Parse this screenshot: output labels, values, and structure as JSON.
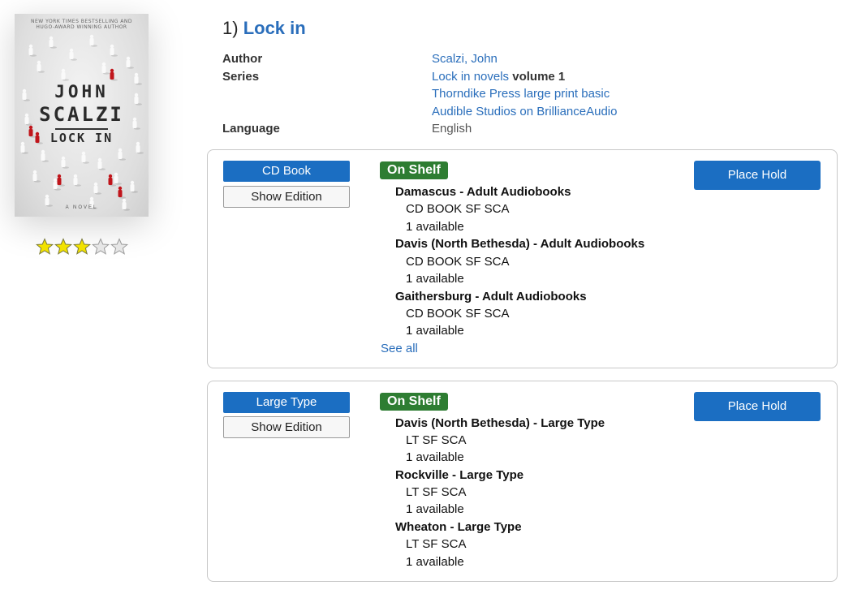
{
  "record": {
    "index": "1)",
    "title": "Lock in",
    "rating": 3,
    "rating_max": 5,
    "star_color": "#f2e200",
    "cover": {
      "tagline_1": "NEW YORK TIMES BESTSELLING AND",
      "tagline_2": "HUGO-AWARD WINNING AUTHOR",
      "author_first": "JOHN",
      "author_last": "SCALZI",
      "title": "LOCK IN",
      "subtitle": "A NOVEL"
    }
  },
  "details": {
    "author_label": "Author",
    "author_value": "Scalzi, John",
    "series_label": "Series",
    "series_value": "Lock in novels",
    "series_volume": "volume 1",
    "series_extra_1": "Thorndike Press large print basic",
    "series_extra_2": "Audible Studios on BrillianceAudio",
    "language_label": "Language",
    "language_value": "English"
  },
  "formats": [
    {
      "format_label": "CD Book",
      "show_edition_label": "Show Edition",
      "status": "On Shelf",
      "place_hold_label": "Place Hold",
      "see_all_label": "See all",
      "holdings": [
        {
          "branch": "Damascus - Adult Audiobooks",
          "call_number": "CD BOOK SF SCA",
          "availability": "1 available"
        },
        {
          "branch": "Davis (North Bethesda) - Adult Audiobooks",
          "call_number": "CD BOOK SF SCA",
          "availability": "1 available"
        },
        {
          "branch": "Gaithersburg - Adult Audiobooks",
          "call_number": "CD BOOK SF SCA",
          "availability": "1 available"
        }
      ]
    },
    {
      "format_label": "Large Type",
      "show_edition_label": "Show Edition",
      "status": "On Shelf",
      "place_hold_label": "Place Hold",
      "holdings": [
        {
          "branch": "Davis (North Bethesda) - Large Type",
          "call_number": "LT SF SCA",
          "availability": "1 available"
        },
        {
          "branch": "Rockville - Large Type",
          "call_number": "LT SF SCA",
          "availability": "1 available"
        },
        {
          "branch": "Wheaton - Large Type",
          "call_number": "LT SF SCA",
          "availability": "1 available"
        }
      ]
    }
  ],
  "colors": {
    "link": "#2a6ebb",
    "primary_button": "#1b6ec2",
    "status_badge": "#2e7d32"
  }
}
